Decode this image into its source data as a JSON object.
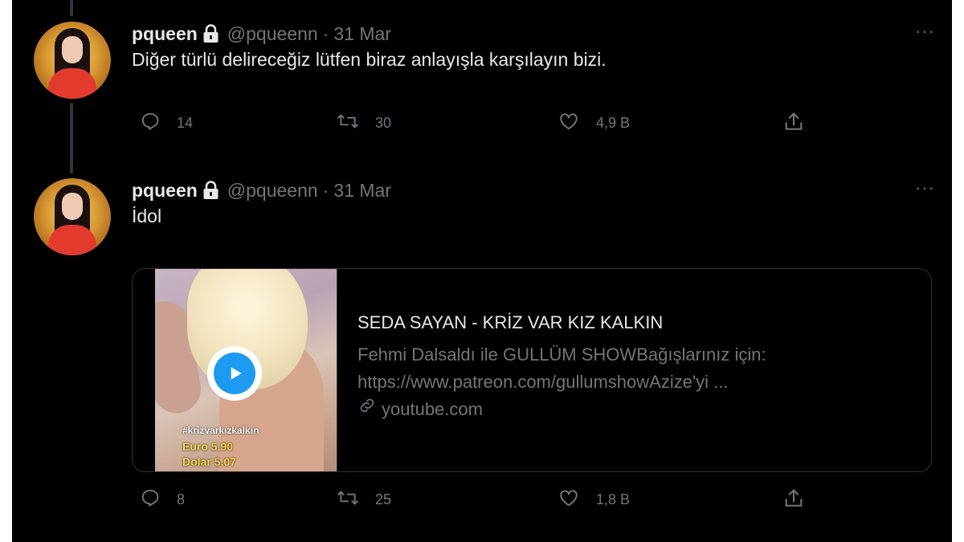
{
  "tweets": [
    {
      "name": "pqueen",
      "handle": "@pqueenn",
      "separator": "·",
      "date": "31 Mar",
      "text": "Diğer türlü delireceğiz lütfen biraz anlayışla karşılayın bizi.",
      "more": "···",
      "actions": {
        "replies": "14",
        "retweets": "30",
        "likes": "4,9 B"
      }
    },
    {
      "name": "pqueen",
      "handle": "@pqueenn",
      "separator": "·",
      "date": "31 Mar",
      "text": "İdol",
      "more": "···",
      "card": {
        "title": "SEDA SAYAN - KRİZ VAR KIZ KALKIN",
        "description_line1": "Fehmi Dalsaldı ile GULLÜM SHOWBağışlarınız için:",
        "description_line2": "https://www.patreon.com/gullumshowAzize'yi ...",
        "domain": "youtube.com",
        "thumbnail_tag": "#krizvarkızkalkın",
        "thumbnail_euro": "Euro 5.90",
        "thumbnail_dolar": "Dolar 5.07"
      },
      "actions": {
        "replies": "8",
        "retweets": "25",
        "likes": "1,8 B"
      }
    }
  ],
  "colors": {
    "background": "#000000",
    "text_primary": "#e7e9ea",
    "text_secondary": "#71767b",
    "accent": "#1d9bf0",
    "border": "#2f3336"
  },
  "icons": [
    "lock-icon",
    "more-icon",
    "reply-icon",
    "retweet-icon",
    "like-icon",
    "share-icon",
    "play-icon",
    "link-icon"
  ]
}
